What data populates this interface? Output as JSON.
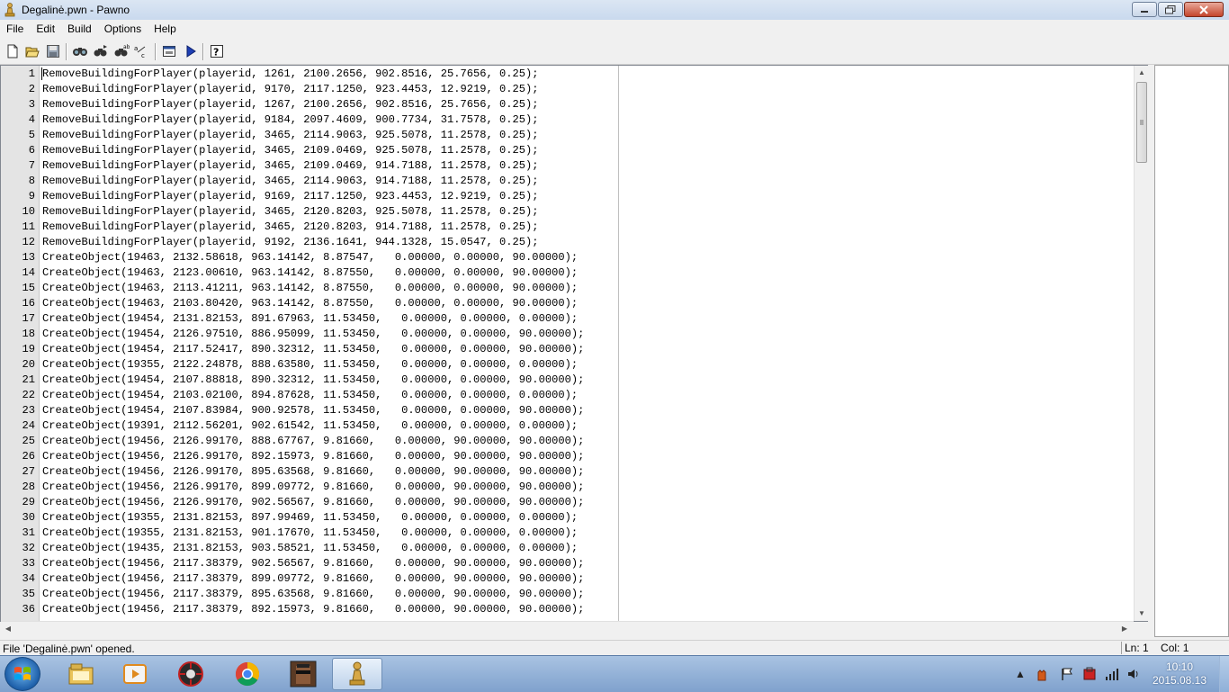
{
  "window": {
    "title": "Degalinė.pwn - Pawno",
    "minimize": "–",
    "maximize": "❐",
    "close": "✕"
  },
  "menu": [
    "File",
    "Edit",
    "Build",
    "Options",
    "Help"
  ],
  "toolbar": {
    "buttons": [
      "new-file-icon",
      "open-file-icon",
      "save-icon",
      "find-icon",
      "find-next-icon",
      "replace-icon",
      "goto-icon",
      "compile-icon",
      "run-icon",
      "help-icon"
    ]
  },
  "editor": {
    "lines": [
      {
        "n": "1",
        "text": "RemoveBuildingForPlayer(playerid, 1261, 2100.2656, 902.8516, 25.7656, 0.25);"
      },
      {
        "n": "2",
        "text": "RemoveBuildingForPlayer(playerid, 9170, 2117.1250, 923.4453, 12.9219, 0.25);"
      },
      {
        "n": "3",
        "text": "RemoveBuildingForPlayer(playerid, 1267, 2100.2656, 902.8516, 25.7656, 0.25);"
      },
      {
        "n": "4",
        "text": "RemoveBuildingForPlayer(playerid, 9184, 2097.4609, 900.7734, 31.7578, 0.25);"
      },
      {
        "n": "5",
        "text": "RemoveBuildingForPlayer(playerid, 3465, 2114.9063, 925.5078, 11.2578, 0.25);"
      },
      {
        "n": "6",
        "text": "RemoveBuildingForPlayer(playerid, 3465, 2109.0469, 925.5078, 11.2578, 0.25);"
      },
      {
        "n": "7",
        "text": "RemoveBuildingForPlayer(playerid, 3465, 2109.0469, 914.7188, 11.2578, 0.25);"
      },
      {
        "n": "8",
        "text": "RemoveBuildingForPlayer(playerid, 3465, 2114.9063, 914.7188, 11.2578, 0.25);"
      },
      {
        "n": "9",
        "text": "RemoveBuildingForPlayer(playerid, 9169, 2117.1250, 923.4453, 12.9219, 0.25);"
      },
      {
        "n": "10",
        "text": "RemoveBuildingForPlayer(playerid, 3465, 2120.8203, 925.5078, 11.2578, 0.25);"
      },
      {
        "n": "11",
        "text": "RemoveBuildingForPlayer(playerid, 3465, 2120.8203, 914.7188, 11.2578, 0.25);"
      },
      {
        "n": "12",
        "text": "RemoveBuildingForPlayer(playerid, 9192, 2136.1641, 944.1328, 15.0547, 0.25);"
      },
      {
        "n": "13",
        "text": "CreateObject(19463, 2132.58618, 963.14142, 8.87547,   0.00000, 0.00000, 90.00000);"
      },
      {
        "n": "14",
        "text": "CreateObject(19463, 2123.00610, 963.14142, 8.87550,   0.00000, 0.00000, 90.00000);"
      },
      {
        "n": "15",
        "text": "CreateObject(19463, 2113.41211, 963.14142, 8.87550,   0.00000, 0.00000, 90.00000);"
      },
      {
        "n": "16",
        "text": "CreateObject(19463, 2103.80420, 963.14142, 8.87550,   0.00000, 0.00000, 90.00000);"
      },
      {
        "n": "17",
        "text": "CreateObject(19454, 2131.82153, 891.67963, 11.53450,   0.00000, 0.00000, 0.00000);"
      },
      {
        "n": "18",
        "text": "CreateObject(19454, 2126.97510, 886.95099, 11.53450,   0.00000, 0.00000, 90.00000);"
      },
      {
        "n": "19",
        "text": "CreateObject(19454, 2117.52417, 890.32312, 11.53450,   0.00000, 0.00000, 90.00000);"
      },
      {
        "n": "20",
        "text": "CreateObject(19355, 2122.24878, 888.63580, 11.53450,   0.00000, 0.00000, 0.00000);"
      },
      {
        "n": "21",
        "text": "CreateObject(19454, 2107.88818, 890.32312, 11.53450,   0.00000, 0.00000, 90.00000);"
      },
      {
        "n": "22",
        "text": "CreateObject(19454, 2103.02100, 894.87628, 11.53450,   0.00000, 0.00000, 0.00000);"
      },
      {
        "n": "23",
        "text": "CreateObject(19454, 2107.83984, 900.92578, 11.53450,   0.00000, 0.00000, 90.00000);"
      },
      {
        "n": "24",
        "text": "CreateObject(19391, 2112.56201, 902.61542, 11.53450,   0.00000, 0.00000, 0.00000);"
      },
      {
        "n": "25",
        "text": "CreateObject(19456, 2126.99170, 888.67767, 9.81660,   0.00000, 90.00000, 90.00000);"
      },
      {
        "n": "26",
        "text": "CreateObject(19456, 2126.99170, 892.15973, 9.81660,   0.00000, 90.00000, 90.00000);"
      },
      {
        "n": "27",
        "text": "CreateObject(19456, 2126.99170, 895.63568, 9.81660,   0.00000, 90.00000, 90.00000);"
      },
      {
        "n": "28",
        "text": "CreateObject(19456, 2126.99170, 899.09772, 9.81660,   0.00000, 90.00000, 90.00000);"
      },
      {
        "n": "29",
        "text": "CreateObject(19456, 2126.99170, 902.56567, 9.81660,   0.00000, 90.00000, 90.00000);"
      },
      {
        "n": "30",
        "text": "CreateObject(19355, 2131.82153, 897.99469, 11.53450,   0.00000, 0.00000, 0.00000);"
      },
      {
        "n": "31",
        "text": "CreateObject(19355, 2131.82153, 901.17670, 11.53450,   0.00000, 0.00000, 0.00000);"
      },
      {
        "n": "32",
        "text": "CreateObject(19435, 2131.82153, 903.58521, 11.53450,   0.00000, 0.00000, 0.00000);"
      },
      {
        "n": "33",
        "text": "CreateObject(19456, 2117.38379, 902.56567, 9.81660,   0.00000, 90.00000, 90.00000);"
      },
      {
        "n": "34",
        "text": "CreateObject(19456, 2117.38379, 899.09772, 9.81660,   0.00000, 90.00000, 90.00000);"
      },
      {
        "n": "35",
        "text": "CreateObject(19456, 2117.38379, 895.63568, 9.81660,   0.00000, 90.00000, 90.00000);"
      },
      {
        "n": "36",
        "text": "CreateObject(19456, 2117.38379, 892.15973, 9.81660,   0.00000, 90.00000, 90.00000);"
      }
    ]
  },
  "status": {
    "message": "File 'Degalinė.pwn' opened.",
    "line": "Ln: 1",
    "col": "Col: 1"
  },
  "taskbar": {
    "apps": [
      "file-explorer-icon",
      "media-player-icon",
      "utility-app-icon",
      "chrome-icon",
      "game-character-icon",
      "pawno-icon"
    ],
    "clock_time": "10:10",
    "clock_date": "2015.08.13"
  },
  "colors": {
    "titlebar": "#c9d9ee",
    "gutter": "#e4e4e4",
    "taskbar": "#7fa1cd"
  }
}
